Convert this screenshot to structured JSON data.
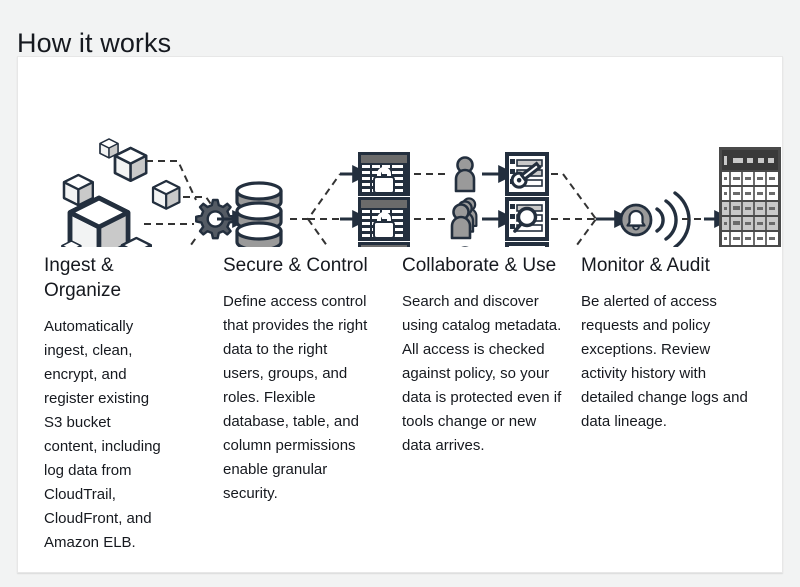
{
  "page": {
    "title": "How it works",
    "background_color": "#f2f3f3",
    "card_background_color": "#ffffff",
    "text_color": "#16191f"
  },
  "diagram": {
    "name": "how-it-works-flow-diagram",
    "icons": [
      {
        "name": "data-cubes-icon",
        "label": "Data objects"
      },
      {
        "name": "gear-icon",
        "label": "Processing"
      },
      {
        "name": "database-icon",
        "label": "Data lake storage"
      },
      {
        "name": "locked-table-icon",
        "label": "Secured table"
      },
      {
        "name": "locked-table-icon",
        "label": "Secured table"
      },
      {
        "name": "locked-table-icon",
        "label": "Secured table"
      },
      {
        "name": "user-icon",
        "label": "User"
      },
      {
        "name": "user-group-icon",
        "label": "User group"
      },
      {
        "name": "user-icon",
        "label": "User"
      },
      {
        "name": "document-key-icon",
        "label": "Access granted"
      },
      {
        "name": "document-search-icon",
        "label": "Search catalog"
      },
      {
        "name": "document-key-icon",
        "label": "Access granted"
      },
      {
        "name": "alert-bell-icon",
        "label": "Alerts"
      },
      {
        "name": "audit-table-icon",
        "label": "Audit log"
      }
    ],
    "colors": {
      "outline": "#232f3e",
      "fill_light": "#f2f3f3",
      "fill_mid": "#b8b8b8",
      "fill_dark": "#545b64",
      "connector": "#333333"
    }
  },
  "columns": [
    {
      "heading": "Ingest & Organize",
      "body": "Automatically ingest, clean, encrypt, and register existing S3 bucket content, including log data from CloudTrail, CloudFront, and Amazon ELB."
    },
    {
      "heading": "Secure & Control",
      "body": "Define access control that provides the right data to the right users, groups, and roles. Flexible database, table, and column permissions enable granular security."
    },
    {
      "heading": "Collaborate & Use",
      "body": "Search and discover using catalog metadata. All access is checked against policy, so your data is protected even if tools change or new data arrives."
    },
    {
      "heading": "Monitor & Audit",
      "body": "Be alerted of access requests and policy exceptions. Review activity history with detailed change logs and data lineage."
    }
  ]
}
